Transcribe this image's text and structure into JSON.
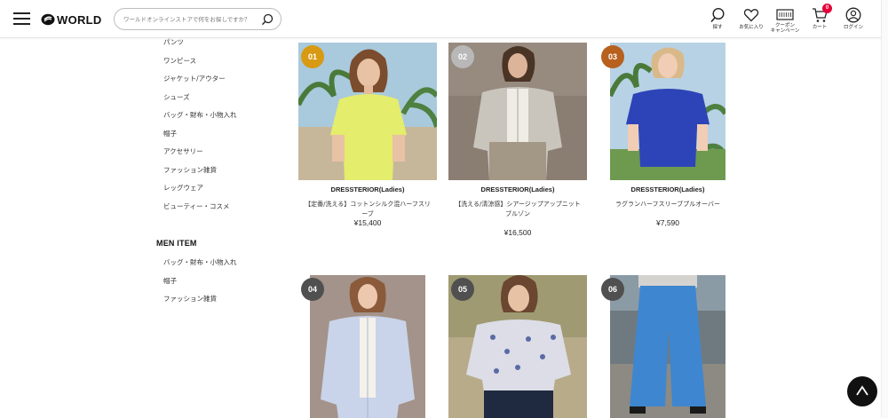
{
  "header": {
    "logo_text": "WORLD",
    "search_placeholder": "ワールドオンラインストアで何をお探しですか？",
    "icons": [
      {
        "name": "search-icon",
        "label": "探す"
      },
      {
        "name": "heart-icon",
        "label": "お気に入り"
      },
      {
        "name": "coupon-icon",
        "label": "クーポン\nキャンペーン"
      },
      {
        "name": "cart-icon",
        "label": "カート",
        "badge": "0"
      },
      {
        "name": "user-icon",
        "label": "ログイン"
      }
    ],
    "badge_color": "#e8003a"
  },
  "sidebar": {
    "women_items": [
      "パンツ",
      "ワンピース",
      "ジャケット/アウター",
      "シューズ",
      "バッグ・財布・小物入れ",
      "帽子",
      "アクセサリー",
      "ファッション雑貨",
      "レッグウェア",
      "ビューティー・コスメ"
    ],
    "men_heading": "MEN ITEM",
    "men_items": [
      "バッグ・財布・小物入れ",
      "帽子",
      "ファッション雑貨"
    ]
  },
  "products": [
    {
      "rank": "01",
      "rank_color": "#d79a12",
      "brand": "DRESSTERIOR(Ladies)",
      "name": "【定番/洗える】コットンシルク混ハーフスリーブ",
      "price": "¥15,400",
      "image": "yellow-knit-top"
    },
    {
      "rank": "02",
      "rank_color": "#b8b8b8",
      "brand": "DRESSTERIOR(Ladies)",
      "name": "【洗える/清涼感】シアージップアップニットブルゾン",
      "price": "¥16,500",
      "image": "grey-zip-cardigan"
    },
    {
      "rank": "03",
      "rank_color": "#b8601e",
      "brand": "DRESSTERIOR(Ladies)",
      "name": "ラグランハーフスリーブプルオーバー",
      "price": "¥7,590",
      "image": "blue-knit-top"
    },
    {
      "rank": "04",
      "rank_color": "#505050",
      "brand": "",
      "name": "",
      "price": "",
      "image": "light-blue-shirt"
    },
    {
      "rank": "05",
      "rank_color": "#505050",
      "brand": "",
      "name": "",
      "price": "",
      "image": "floral-blouse"
    },
    {
      "rank": "06",
      "rank_color": "#505050",
      "brand": "",
      "name": "",
      "price": "",
      "image": "denim-wide-pants"
    }
  ],
  "back_to_top_icon": "chevron-up-icon"
}
